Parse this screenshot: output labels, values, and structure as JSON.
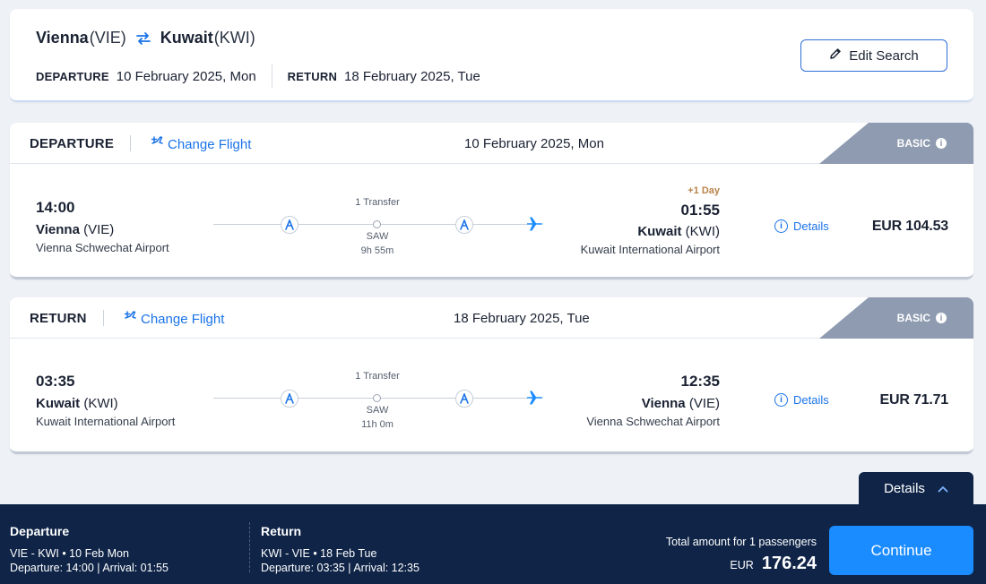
{
  "search": {
    "origin_city": "Vienna",
    "origin_code": "(VIE)",
    "dest_city": "Kuwait",
    "dest_code": "(KWI)",
    "departure_label": "DEPARTURE",
    "departure_date": "10 February 2025, Mon",
    "return_label": "RETURN",
    "return_date": "18 February 2025, Tue",
    "edit_label": "Edit Search"
  },
  "flights": [
    {
      "title": "DEPARTURE",
      "change_label": "Change Flight",
      "date": "10 February 2025, Mon",
      "fare_class": "BASIC",
      "dep_time": "14:00",
      "dep_city": "Vienna",
      "dep_code": "(VIE)",
      "dep_airport": "Vienna Schwechat Airport",
      "transfer": "1 Transfer",
      "stop": "SAW",
      "duration": "9h 55m",
      "plus_day": "+1 Day",
      "arr_time": "01:55",
      "arr_city": "Kuwait",
      "arr_code": "(KWI)",
      "arr_airport": "Kuwait International Airport",
      "details_label": "Details",
      "price": "EUR 104.53"
    },
    {
      "title": "RETURN",
      "change_label": "Change Flight",
      "date": "18 February 2025, Tue",
      "fare_class": "BASIC",
      "dep_time": "03:35",
      "dep_city": "Kuwait",
      "dep_code": "(KWI)",
      "dep_airport": "Kuwait International Airport",
      "transfer": "1 Transfer",
      "stop": "SAW",
      "duration": "11h 0m",
      "plus_day": "",
      "arr_time": "12:35",
      "arr_city": "Vienna",
      "arr_code": "(VIE)",
      "arr_airport": "Vienna Schwechat Airport",
      "details_label": "Details",
      "price": "EUR 71.71"
    }
  ],
  "summary": {
    "details_tab": "Details",
    "departure_heading": "Departure",
    "departure_route": "VIE - KWI • 10 Feb Mon",
    "departure_times": "Departure: 14:00 | Arrival: 01:55",
    "return_heading": "Return",
    "return_route": "KWI - VIE • 18 Feb Tue",
    "return_times": "Departure: 03:35 | Arrival: 12:35",
    "total_label": "Total amount for 1 passengers",
    "currency": "EUR",
    "total": "176.24",
    "continue_label": "Continue"
  },
  "colors": {
    "accent": "#1a73e8",
    "navy": "#0f2447",
    "button": "#1a8cff",
    "fare_tab": "#8e9bb0",
    "plus_day": "#b8834a"
  },
  "icons": [
    "swap-arrows-icon",
    "pencil-icon",
    "change-flight-icon",
    "info-icon",
    "airline-logo-icon",
    "plane-icon",
    "chevron-up-icon"
  ]
}
